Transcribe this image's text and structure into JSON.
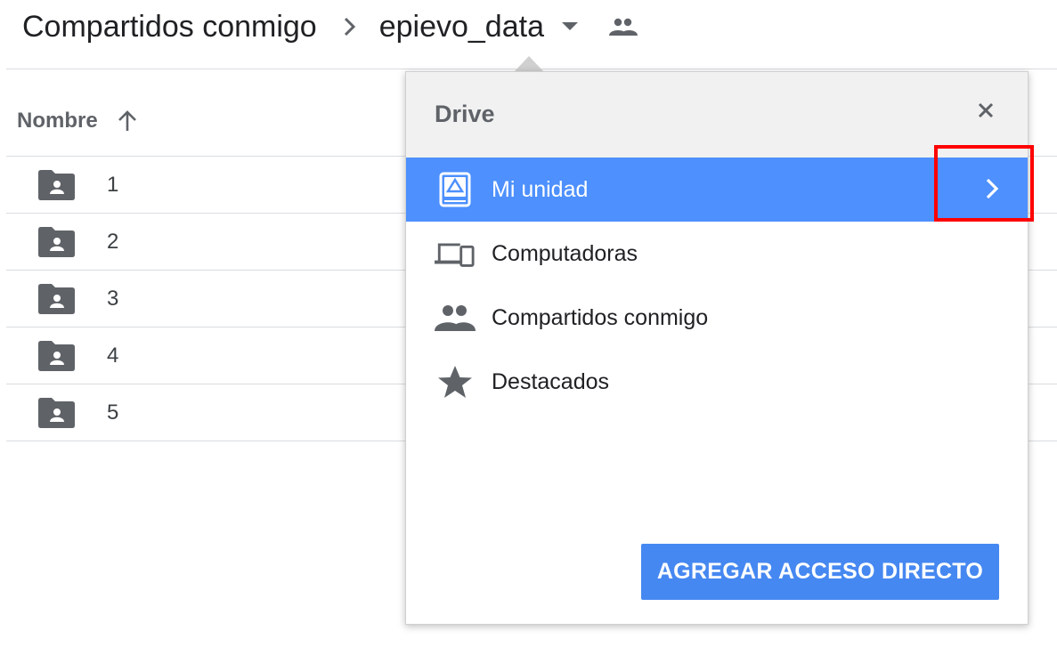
{
  "breadcrumb": {
    "parent": "Compartidos conmigo",
    "separator_icon": "chevron-right-icon",
    "current": "epievo_data",
    "caret_icon": "caret-down-icon",
    "shared_icon": "people-icon"
  },
  "file_list": {
    "column_header": "Nombre",
    "sort_icon": "arrow-up-icon",
    "rows": [
      {
        "name": "1",
        "icon": "shared-folder-icon"
      },
      {
        "name": "2",
        "icon": "shared-folder-icon"
      },
      {
        "name": "3",
        "icon": "shared-folder-icon"
      },
      {
        "name": "4",
        "icon": "shared-folder-icon"
      },
      {
        "name": "5",
        "icon": "shared-folder-icon"
      }
    ]
  },
  "popup": {
    "title": "Drive",
    "close_icon": "close-icon",
    "items": [
      {
        "label": "Mi unidad",
        "icon": "drive-icon",
        "selected": true
      },
      {
        "label": "Computadoras",
        "icon": "computers-icon",
        "selected": false
      },
      {
        "label": "Compartidos conmigo",
        "icon": "people-icon",
        "selected": false
      },
      {
        "label": "Destacados",
        "icon": "star-icon",
        "selected": false
      }
    ],
    "add_shortcut_label": "AGREGAR ACCESO DIRECTO"
  },
  "colors": {
    "selected_bg": "#4d90fe",
    "button_bg": "#4688f1",
    "highlight": "#ff0000",
    "icon_gray": "#5f6368"
  }
}
